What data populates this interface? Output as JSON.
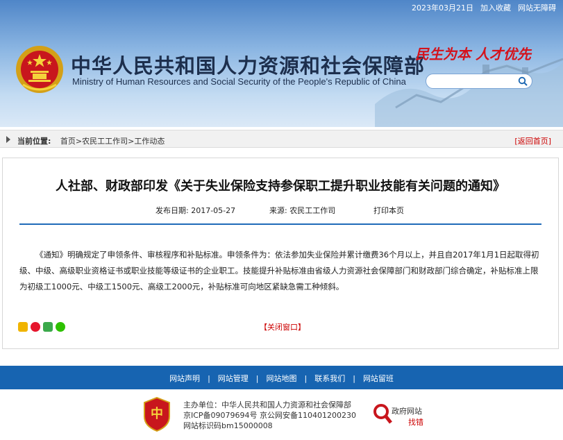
{
  "topbar": {
    "date": "2023年03月21日",
    "favorite": "加入收藏",
    "accessibility": "网站无障碍"
  },
  "header": {
    "title": "中华人民共和国人力资源和社会保障部",
    "subtitle": "Ministry of Human Resources and Social Security of the People's Republic of China",
    "slogan": "民生为本  人才优先"
  },
  "search": {
    "value": "",
    "placeholder": ""
  },
  "breadcrumb": {
    "label": "当前位置:",
    "items": [
      "首页",
      "农民工工作司",
      "工作动态"
    ],
    "separator": ">",
    "back": "[返回首页]"
  },
  "article": {
    "title": "人社部、财政部印发《关于失业保险支持参保职工提升职业技能有关问题的通知》",
    "publish_date": "发布日期: 2017-05-27",
    "source": "来源: 农民工工作司",
    "print": "打印本页",
    "body": "《通知》明确规定了申领条件、审核程序和补贴标准。申领条件为：依法参加失业保险并累计缴费36个月以上，并且自2017年1月1日起取得初级、中级、高级职业资格证书或职业技能等级证书的企业职工。技能提升补贴标准由省级人力资源社会保障部门和财政部门综合确定，补贴标准上限为初级工1000元、中级工1500元、高级工2000元，补贴标准可向地区紧缺急需工种倾斜。",
    "close": "【关闭窗口】"
  },
  "share_icons": [
    "qzone-icon",
    "weibo-icon",
    "douban-icon",
    "wechat-icon"
  ],
  "footer": {
    "nav": [
      "网站声明",
      "网站管理",
      "网站地图",
      "联系我们",
      "网站留班"
    ],
    "host": "主办单位：中华人民共和国人力资源和社会保障部",
    "icp": "京ICP备09079694号 京公网安备110401200230",
    "site_id": "网站标识码bm15000008",
    "find_error_top": "政府网站",
    "find_error_bottom": "找错"
  },
  "colors": {
    "brand_blue": "#1764b1",
    "alert_red": "#cc0000",
    "slogan_red": "#d4121b"
  }
}
